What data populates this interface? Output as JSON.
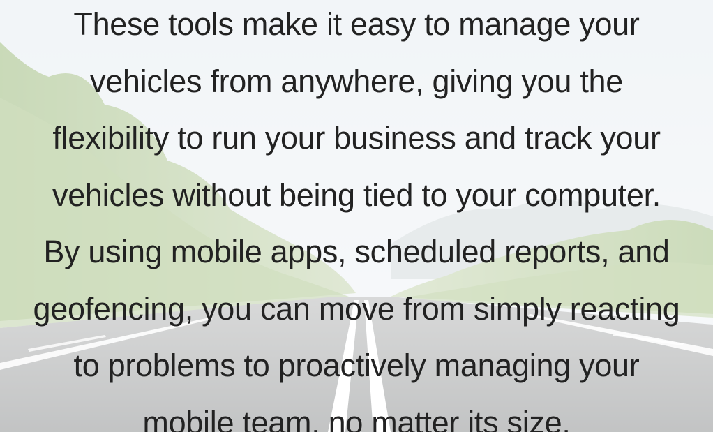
{
  "content": {
    "lines": [
      "These tools make it easy to manage your",
      "vehicles from anywhere, giving you the",
      "flexibility to run your business and track your",
      "vehicles without being tied to your computer.",
      "By using mobile apps, scheduled reports, and",
      "geofencing, you can move from simply reacting",
      "to problems to proactively managing your",
      "mobile team, no matter its size."
    ]
  },
  "colors": {
    "text": "#222222",
    "sky": "#e9eef2",
    "foliage": "#9cb870",
    "road": "#8d8f8f",
    "road_marking": "#ffffff"
  }
}
